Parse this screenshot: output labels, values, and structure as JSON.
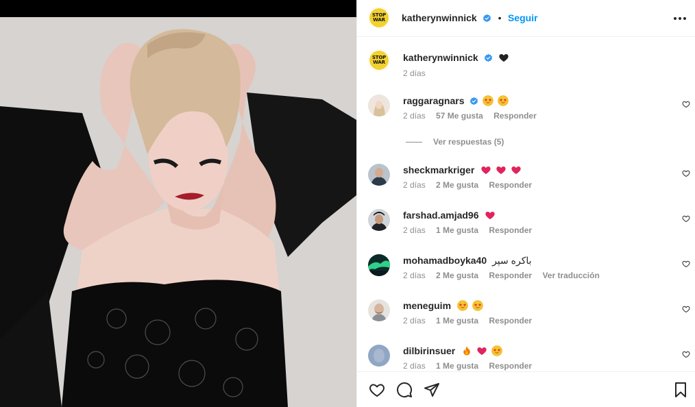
{
  "post": {
    "owner": "katherynwinnick",
    "follow_label": "Seguir",
    "separator": "•",
    "avatar_text_line1": "STOP",
    "avatar_text_line2": "WAR",
    "caption_time": "2 días"
  },
  "comments": [
    {
      "user": "raggaragnars",
      "verified": true,
      "emoji": [
        "star-eyes",
        "star-eyes"
      ],
      "time": "2 días",
      "likes": "57 Me gusta",
      "reply": "Responder",
      "view_replies": "Ver respuestas (5)"
    },
    {
      "user": "sheckmarkriger",
      "verified": false,
      "emoji": [
        "red-heart",
        "red-heart",
        "red-heart"
      ],
      "time": "2 días",
      "likes": "2 Me gusta",
      "reply": "Responder"
    },
    {
      "user": "farshad.amjad96",
      "verified": false,
      "emoji": [
        "red-heart"
      ],
      "time": "2 días",
      "likes": "1 Me gusta",
      "reply": "Responder"
    },
    {
      "user": "mohamadboyka40",
      "verified": false,
      "text": "باكره سپر",
      "time": "2 días",
      "likes": "2 Me gusta",
      "reply": "Responder",
      "translate": "Ver traducción"
    },
    {
      "user": "meneguim",
      "verified": false,
      "emoji": [
        "star-eyes",
        "star-eyes"
      ],
      "time": "2 días",
      "likes": "1 Me gusta",
      "reply": "Responder"
    },
    {
      "user": "dilbirinsuer",
      "verified": false,
      "emoji": [
        "fire",
        "red-heart",
        "star-eyes"
      ],
      "time": "2 días",
      "likes": "1 Me gusta",
      "reply": "Responder"
    }
  ],
  "colors": {
    "accent": "#0095f6",
    "verified": "#3897f0",
    "muted": "#8e8e8e",
    "heart": "#ed4956",
    "avatar_yellow": "#f2d230"
  },
  "icons": [
    "verified-badge-icon",
    "black-heart-icon",
    "more-options-icon",
    "like-icon",
    "comment-icon",
    "share-icon",
    "save-icon",
    "comment-like-icon"
  ]
}
